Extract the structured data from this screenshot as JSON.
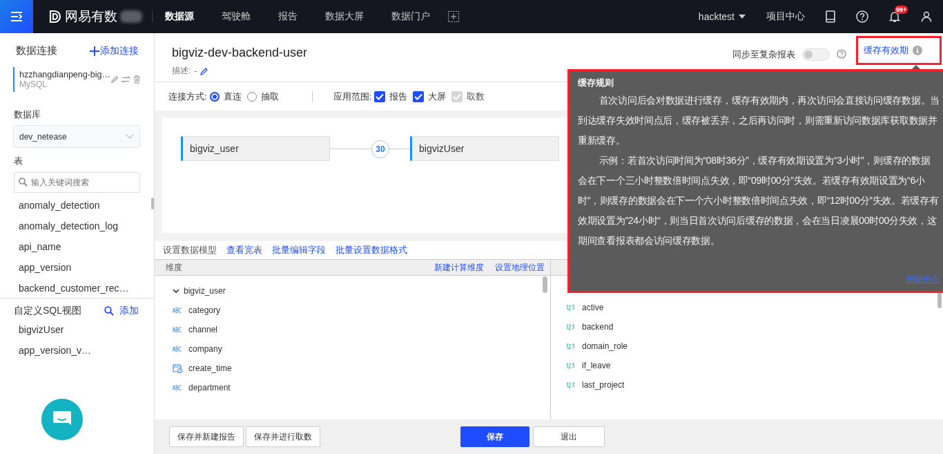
{
  "topbar": {
    "brand": "网易有数",
    "nav": [
      {
        "label": "数据源",
        "selected": true
      },
      {
        "label": "驾驶舱",
        "selected": false
      },
      {
        "label": "报告",
        "selected": false
      },
      {
        "label": "数据大屏",
        "selected": false
      },
      {
        "label": "数据门户",
        "selected": false
      }
    ],
    "user": "hacktest",
    "project_center": "项目中心",
    "notification_badge": "99+"
  },
  "sidebar": {
    "title": "数据连接",
    "add_connection": "添加连接",
    "connection": {
      "name": "hzzhangdianpeng-big…",
      "type": "MySQL"
    },
    "database_label": "数据库",
    "database": "dev_netease",
    "table_label": "表",
    "search": {
      "placeholder": "输入关键词搜索"
    },
    "tables": [
      "anomaly_detection",
      "anomaly_detection_log",
      "api_name",
      "app_version",
      "backend_customer_rec…"
    ],
    "sql_view_title": "自定义SQL视图",
    "sql_view_add": "添加",
    "sql_views": [
      "bigvizUser",
      "app_version_v…"
    ]
  },
  "header": {
    "title": "bigviz-dev-backend-user",
    "description_label": "描述:",
    "description": "-",
    "sync_label": "同步至复杂报表",
    "sync_on": false,
    "cache_link": "缓存有效期"
  },
  "options": {
    "connect_label": "连接方式:",
    "connect_modes": [
      {
        "label": "直连",
        "selected": true
      },
      {
        "label": "抽取",
        "selected": false
      }
    ],
    "scope_label": "应用范围:",
    "scopes": [
      {
        "label": "报告",
        "checked": true,
        "disabled": false
      },
      {
        "label": "大屏",
        "checked": true,
        "disabled": false
      },
      {
        "label": "取数",
        "checked": true,
        "disabled": true
      }
    ]
  },
  "diagram": {
    "left": "bigviz_user",
    "join_count": "30",
    "right": "bigvizUser"
  },
  "toolbar": {
    "title": "设置数据模型",
    "links": [
      "查看宽表",
      "批量编辑字段",
      "批量设置数据格式"
    ]
  },
  "dimensions": {
    "header": "维度",
    "actions": [
      "新建计算维度",
      "设置地理位置"
    ],
    "group": {
      "name": "bigviz_user",
      "expanded": true,
      "children": [
        {
          "name": "category",
          "kind": "text"
        },
        {
          "name": "channel",
          "kind": "text"
        },
        {
          "name": "company",
          "kind": "text"
        },
        {
          "name": "create_time",
          "kind": "date"
        },
        {
          "name": "department",
          "kind": "text"
        }
      ]
    }
  },
  "measures": {
    "fields": [
      "active",
      "backend",
      "domain_role",
      "if_leave",
      "last_project"
    ]
  },
  "tooltip": {
    "title": "缓存规则",
    "paragraphs": [
      "首次访问后会对数据进行缓存，缓存有效期内，再次访问会直接访问缓存数据。当到达缓存失效时间点后，缓存被丢弃，之后再访问时，则需重新访问数据库获取数据并重新缓存。",
      "示例：若首次访问时间为“08时36分”，缓存有效期设置为“3小时”，则缓存的数据会在下一个三小时整数倍时间点失效，即“09时00分”失效。若缓存有效期设置为“6小时”，则缓存的数据会在下一个六小时整数倍时间点失效，即“12时00分”失效。若缓存有效期设置为”24小时“，则当日首次访问后缓存的数据，会在当日凌晨00时00分失效，这期间查看报表都会访问缓存数据。"
    ],
    "help_link": "帮助中心"
  },
  "footer": {
    "buttons": [
      {
        "label": "保存并新建报告",
        "kind": "default"
      },
      {
        "label": "保存并进行取数",
        "kind": "default"
      },
      {
        "label": "保存",
        "kind": "primary"
      },
      {
        "label": "退出",
        "kind": "default"
      }
    ]
  }
}
